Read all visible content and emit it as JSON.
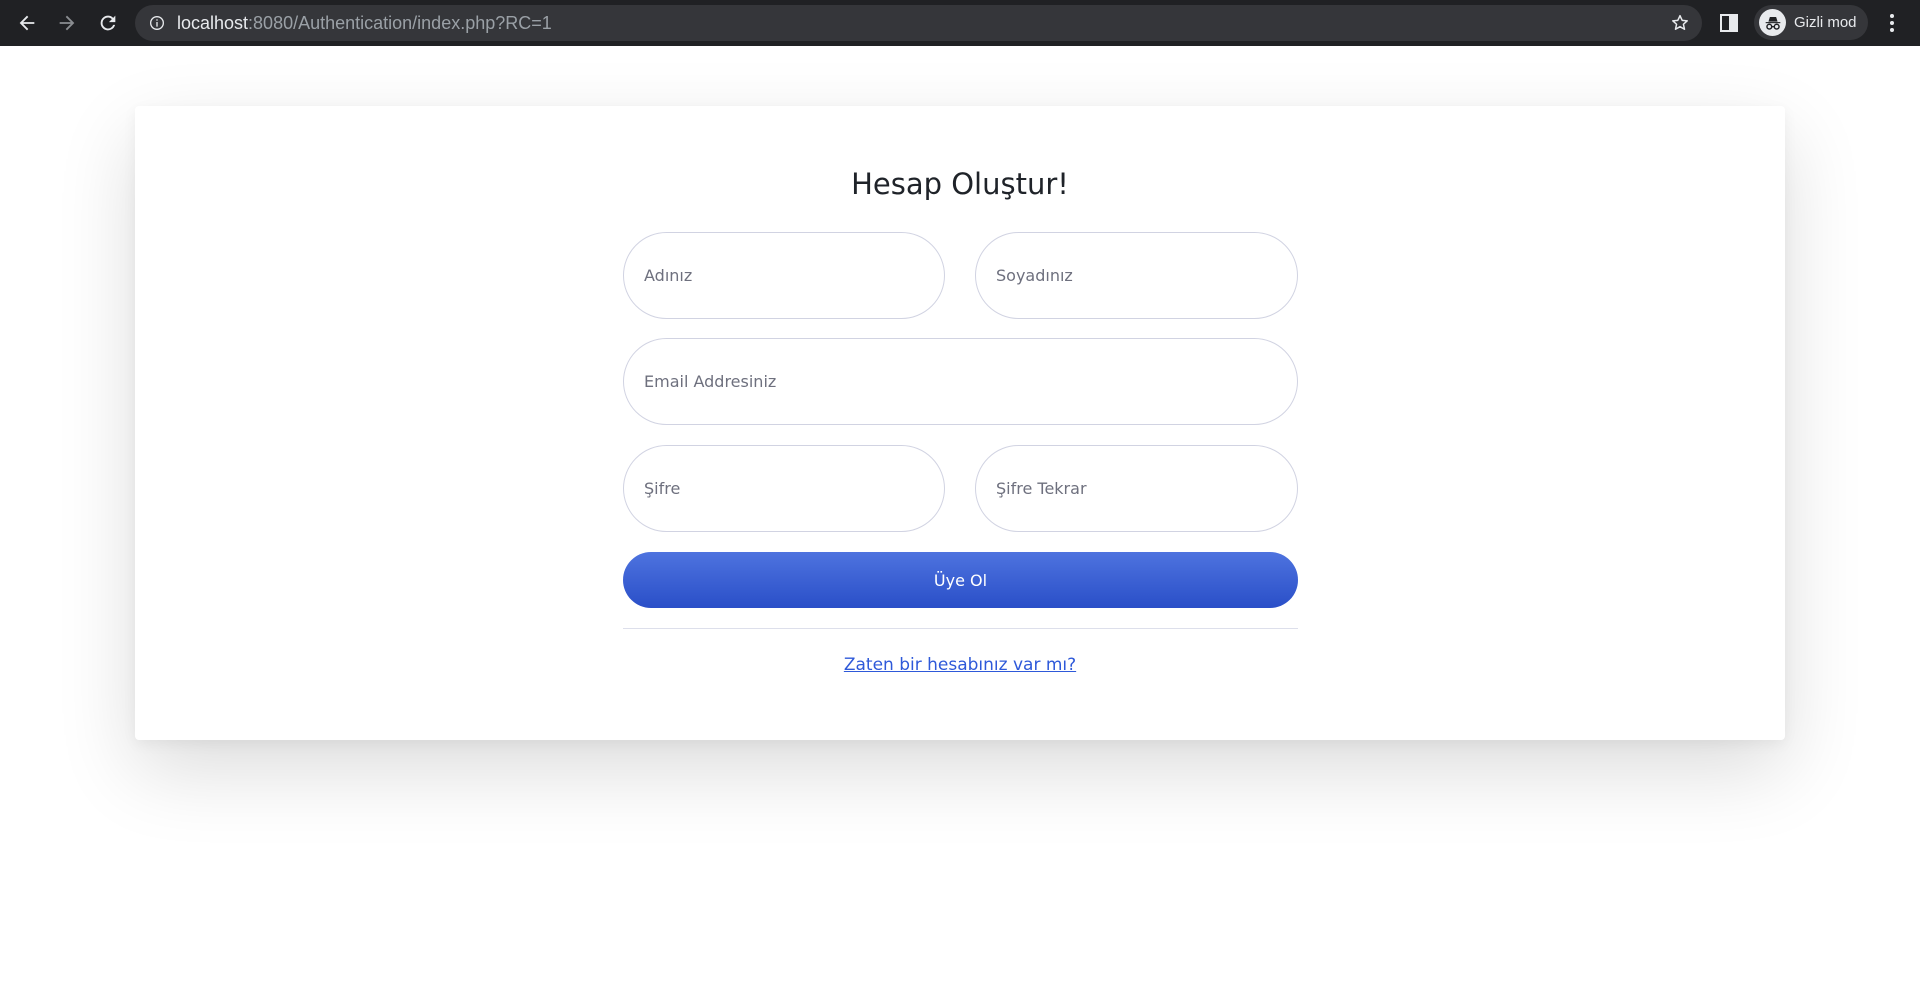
{
  "browser": {
    "url_host": "localhost",
    "url_rest": ":8080/Authentication/index.php?RC=1",
    "profile_label": "Gizli mod"
  },
  "form": {
    "title": "Hesap Oluştur!",
    "first_name_placeholder": "Adınız",
    "last_name_placeholder": "Soyadınız",
    "email_placeholder": "Email Addresiniz",
    "password_placeholder": "Şifre",
    "password_repeat_placeholder": "Şifre Tekrar",
    "submit_label": "Üye Ol",
    "login_link": "Zaten bir hesabınız var mı?"
  },
  "colors": {
    "chrome_bg": "#202124",
    "omnibox_bg": "#35363a",
    "button_primary": "#4e73df",
    "link": "#2e59d9"
  },
  "icons": [
    "back-arrow-icon",
    "forward-arrow-icon",
    "reload-icon",
    "info-icon",
    "star-icon",
    "side-panel-icon",
    "incognito-icon",
    "more-menu-icon"
  ]
}
